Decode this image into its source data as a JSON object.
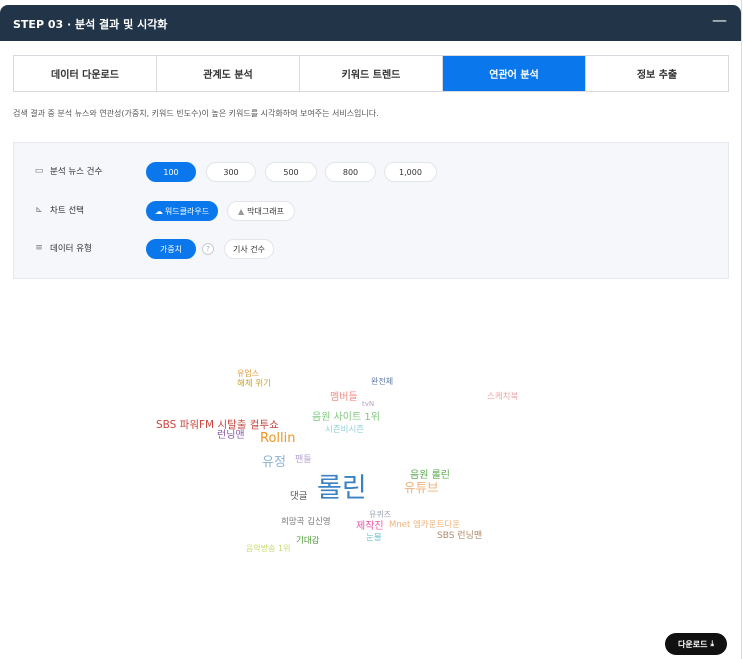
{
  "header": {
    "title": "STEP 03 · 분석 결과 및 시각화",
    "toggle": "—"
  },
  "tabs": [
    {
      "label": "데이터 다운로드",
      "active": false
    },
    {
      "label": "관계도 분석",
      "active": false
    },
    {
      "label": "키워드 트렌드",
      "active": false
    },
    {
      "label": "연관어 분석",
      "active": true
    },
    {
      "label": "정보 추출",
      "active": false
    }
  ],
  "description": "검색 결과 중 분석 뉴스와 연관성(가중치, 키워드 빈도수)이 높은 키워드를 시각화하여 보여주는 서비스입니다.",
  "options": {
    "news_count": {
      "label": "분석 뉴스 건수",
      "values": [
        "100",
        "300",
        "500",
        "800",
        "1,000"
      ],
      "selected": "100"
    },
    "chart": {
      "label": "차트 선택",
      "values": [
        "워드클라우드",
        "막대그래프"
      ],
      "selected": "워드클라우드"
    },
    "data_type": {
      "label": "데이터 유형",
      "values": [
        "가중치",
        "기사 건수"
      ],
      "selected": "가중치",
      "help": "?"
    }
  },
  "word_cloud": [
    {
      "text": "유업스",
      "color": "#e59a3a"
    },
    {
      "text": "해체 위기",
      "color": "#c9a33a"
    },
    {
      "text": "완전체",
      "color": "#5a7aa6"
    },
    {
      "text": "멤버들",
      "color": "#ef8f86"
    },
    {
      "text": "tvN",
      "color": "#b7a0c8"
    },
    {
      "text": "스케치북",
      "color": "#f2a3a3"
    },
    {
      "text": "음원 사이트 1위",
      "color": "#7ec87a"
    },
    {
      "text": "SBS 파워FM 시탈출 컬투쇼",
      "color": "#c8453f"
    },
    {
      "text": "시즌비시즌",
      "color": "#8fd3d8"
    },
    {
      "text": "런닝맨",
      "color": "#8a5aa8"
    },
    {
      "text": "Rollin",
      "color": "#f0941f"
    },
    {
      "text": "유정",
      "color": "#8cb4d8"
    },
    {
      "text": "팬들",
      "color": "#b5a3d0"
    },
    {
      "text": "음원 롤린",
      "color": "#5aa84e"
    },
    {
      "text": "롤린",
      "color": "#3b82c4"
    },
    {
      "text": "댓글",
      "color": "#555555"
    },
    {
      "text": "유튜브",
      "color": "#f0b27a"
    },
    {
      "text": "유퀴즈",
      "color": "#9aa5b5"
    },
    {
      "text": "희망곡 김신영",
      "color": "#777777"
    },
    {
      "text": "제작진",
      "color": "#e55aa8"
    },
    {
      "text": "Mnet 엠카운트다운",
      "color": "#f0b27a"
    },
    {
      "text": "눈물",
      "color": "#6fc3d0"
    },
    {
      "text": "SBS 런닝맨",
      "color": "#b08a6a"
    },
    {
      "text": "기대감",
      "color": "#4e9a3a"
    },
    {
      "text": "음악방송 1위",
      "color": "#c8d86a"
    }
  ],
  "download": {
    "label": "다운로드",
    "icon": "download-icon"
  }
}
